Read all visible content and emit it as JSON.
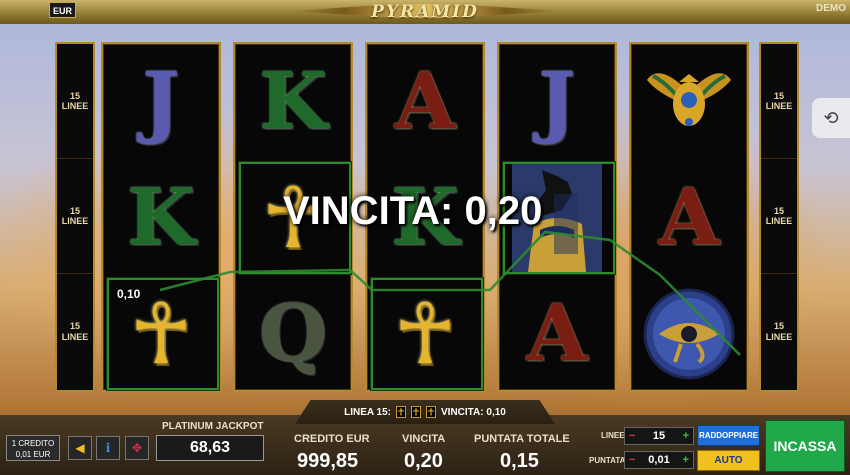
{
  "top_bar": {
    "currency": "EUR",
    "logo": "PYRAMID",
    "mode": "DEMO"
  },
  "lines_indicator": "15\nLINEE",
  "reels": [
    [
      "J",
      "K",
      "ankh"
    ],
    [
      "K",
      "ankh",
      "Q"
    ],
    [
      "A",
      "K",
      "ankh"
    ],
    [
      "J",
      "anubis",
      "A"
    ],
    [
      "scarab",
      "A",
      "eye-of-horus"
    ]
  ],
  "win": {
    "text": "VINCITA: 0,20",
    "symbol_value": "0,10"
  },
  "info_strip": {
    "line": "LINEA 15:",
    "win": "VINCITA: 0,10"
  },
  "credit_box": {
    "line1": "1 CREDITO",
    "line2": "0,01 EUR"
  },
  "jackpot": {
    "label": "PLATINUM JACKPOT",
    "value": "68,63"
  },
  "stats": {
    "credit_label": "CREDITO EUR",
    "credit_value": "999,85",
    "win_label": "VINCITA",
    "win_value": "0,20",
    "bet_label": "PUNTATA TOTALE",
    "bet_value": "0,15"
  },
  "controls": {
    "lines_label": "LINEE",
    "lines_value": "15",
    "bet_label": "PUNTATA",
    "bet_value": "0,01",
    "double_label": "RADDOPPIARE",
    "auto_label": "AUTO",
    "collect_label": "INCASSA"
  },
  "colors": {
    "win_line": "#2f8a2f",
    "gold": "#b48a2c",
    "collect": "#21a84a",
    "double": "#1f6fd8",
    "auto": "#f0c020"
  }
}
